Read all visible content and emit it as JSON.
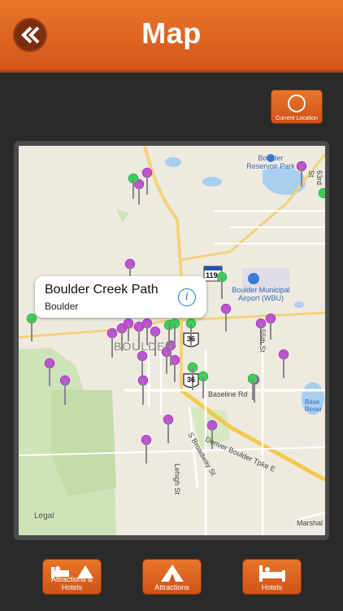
{
  "header": {
    "title": "Map",
    "back_icon": "double-chevron-left-icon"
  },
  "current_location": {
    "label": "Current Location",
    "icon": "crosshair-icon"
  },
  "map": {
    "callout": {
      "title": "Boulder Creek Path",
      "subtitle": "Boulder",
      "icon": "info-icon"
    },
    "legal": "Legal",
    "labels": {
      "boulder": "BOULDER",
      "reservoir": "Boulder Reservoir Park",
      "airport": "Boulder Municipal Airport (WBU)",
      "baseline": "Baseline Rd",
      "turnpike": "Denver Boulder Tpke E",
      "broadway": "S Broadway St",
      "lehigh": "Lehigh St",
      "st55": "55th St",
      "st63": "63rd St",
      "marshall": "Marshal",
      "route36": "36",
      "route119": "119",
      "base_res": "Base Reser"
    }
  },
  "tabs": [
    {
      "label": "Attractions & Hotels",
      "icon": "bed-tent-icon"
    },
    {
      "label": "Attractions",
      "icon": "tent-icon"
    },
    {
      "label": "Hotels",
      "icon": "bed-icon"
    }
  ],
  "colors": {
    "accent": "#e36b22",
    "pin_purple": "#c24fd8",
    "pin_green": "#3ccf5a"
  }
}
